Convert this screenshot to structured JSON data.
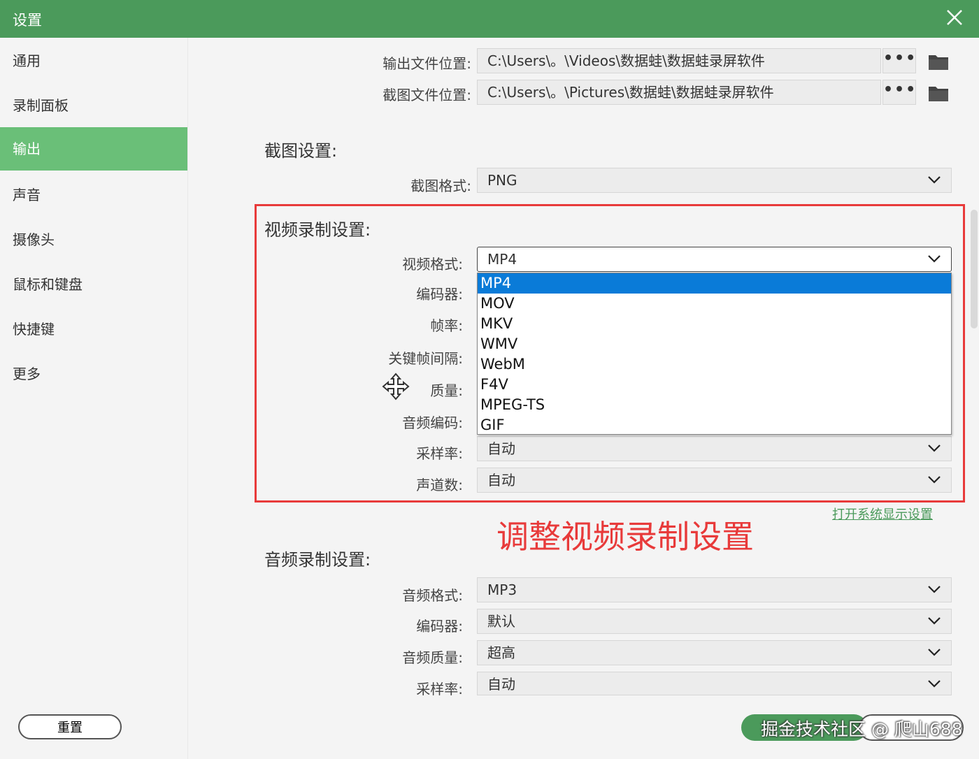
{
  "window": {
    "title": "设置"
  },
  "sidebar": {
    "items": [
      {
        "label": "通用"
      },
      {
        "label": "录制面板"
      },
      {
        "label": "输出"
      },
      {
        "label": "声音"
      },
      {
        "label": "摄像头"
      },
      {
        "label": "鼠标和键盘"
      },
      {
        "label": "快捷键"
      },
      {
        "label": "更多"
      }
    ],
    "active_index": 2,
    "reset_label": "重置"
  },
  "output": {
    "video_path_label": "输出文件位置:",
    "video_path_value": "C:\\Users\\。\\Videos\\数据蛙\\数据蛙录屏软件",
    "image_path_label": "截图文件位置:",
    "image_path_value": "C:\\Users\\。\\Pictures\\数据蛙\\数据蛙录屏软件",
    "browse_label": "•••"
  },
  "screenshot": {
    "section_title": "截图设置:",
    "format_label": "截图格式:",
    "format_value": "PNG"
  },
  "video": {
    "section_title": "视频录制设置:",
    "format_label": "视频格式:",
    "format_value": "MP4",
    "encoder_label": "编码器:",
    "framerate_label": "帧率:",
    "keyframe_label": "关键帧间隔:",
    "quality_label": "质量:",
    "audio_codec_label": "音频编码:",
    "sample_rate_label": "采样率:",
    "sample_rate_value": "自动",
    "channels_label": "声道数:",
    "channels_value": "自动",
    "format_options": [
      "MP4",
      "MOV",
      "MKV",
      "WMV",
      "WebM",
      "F4V",
      "MPEG-TS",
      "GIF"
    ],
    "selected_option_index": 0
  },
  "display_link": "打开系统显示设置",
  "annotation": "调整视频录制设置",
  "audio": {
    "section_title": "音频录制设置:",
    "format_label": "音频格式:",
    "format_value": "MP3",
    "encoder_label": "编码器:",
    "encoder_value": "默认",
    "quality_label": "音频质量:",
    "quality_value": "超高",
    "sample_rate_label": "采样率:",
    "sample_rate_value": "自动"
  },
  "watermark": "掘金技术社区 @ 爬山688",
  "colors": {
    "titlebar": "#4b9a5b",
    "active_nav": "#6abf78",
    "highlight": "#0a7bd8",
    "annotation": "#e83a3a"
  }
}
